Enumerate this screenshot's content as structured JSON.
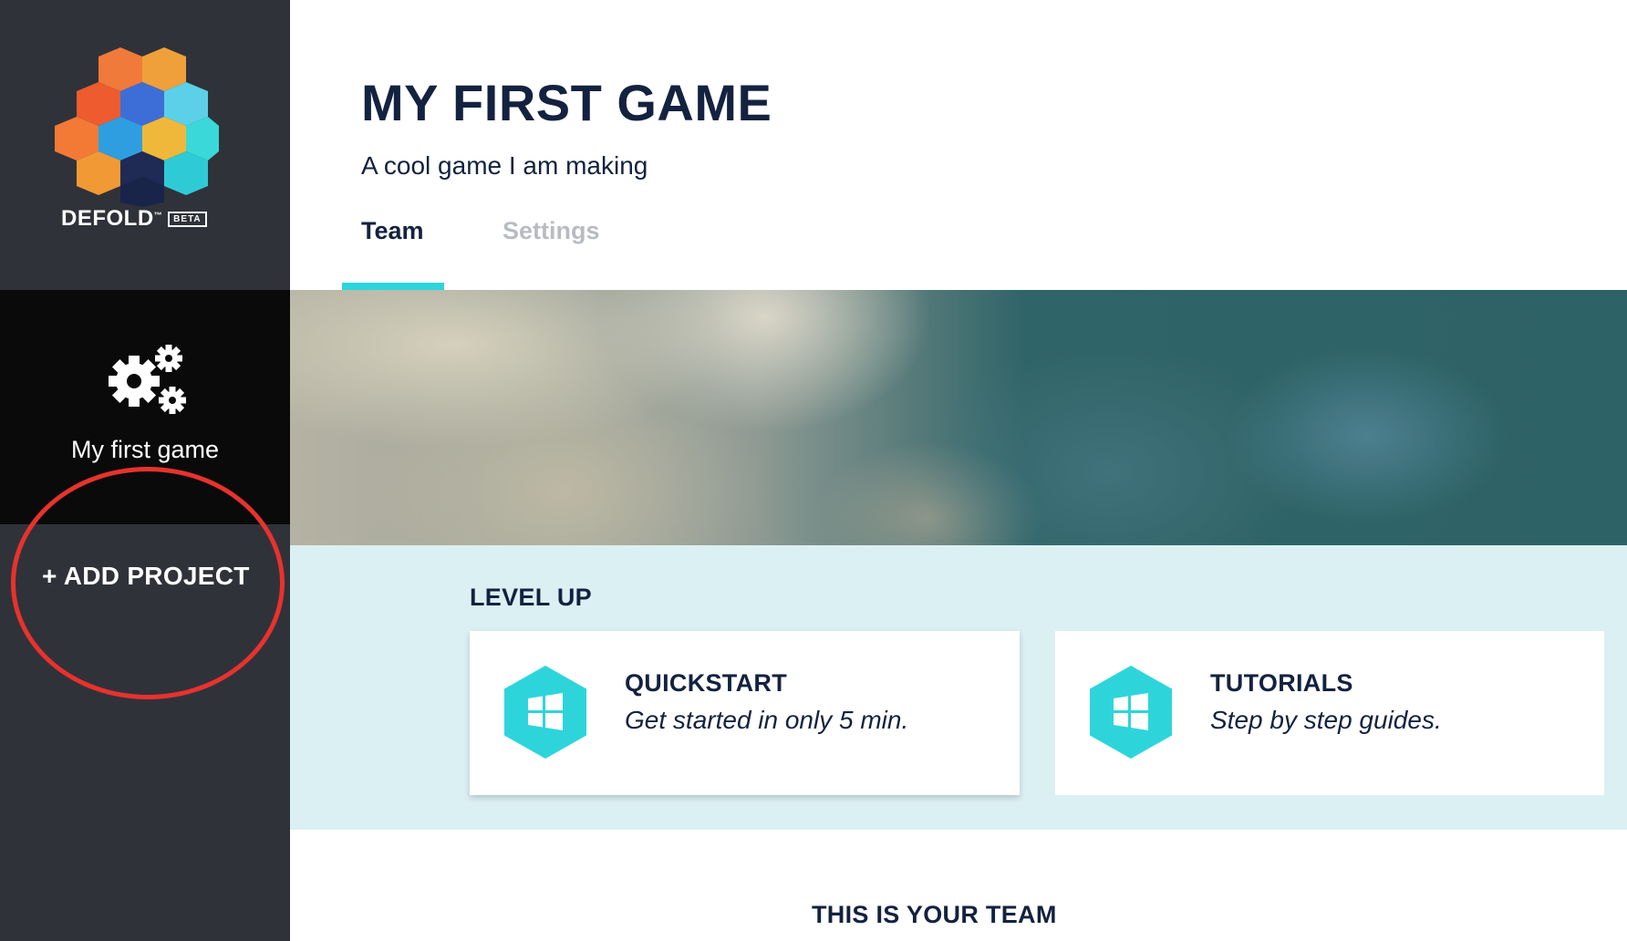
{
  "sidebar": {
    "logo": {
      "name": "DEFOLD",
      "trademark": "™",
      "badge": "BETA"
    },
    "project": {
      "label": "My first game",
      "icon": "gears-icon"
    },
    "add_project_label": "+ ADD PROJECT"
  },
  "main": {
    "title": "MY FIRST GAME",
    "subtitle": "A cool game I am making",
    "tabs": [
      {
        "label": "Team",
        "active": true
      },
      {
        "label": "Settings",
        "active": false
      }
    ],
    "level_up": {
      "title": "LEVEL UP",
      "cards": [
        {
          "title": "QUICKSTART",
          "description": "Get started in only 5 min.",
          "icon": "windows-hex-icon"
        },
        {
          "title": "TUTORIALS",
          "description": "Step by step guides.",
          "icon": "windows-hex-icon"
        }
      ]
    },
    "team_heading": "THIS IS YOUR TEAM"
  },
  "colors": {
    "sidebar_bg": "#30323a",
    "project_bg": "#0a0a0a",
    "accent": "#2dd5db",
    "text_dark": "#13223f",
    "levelup_bg": "#dbf0f3",
    "annotation_red": "#e8322d"
  }
}
